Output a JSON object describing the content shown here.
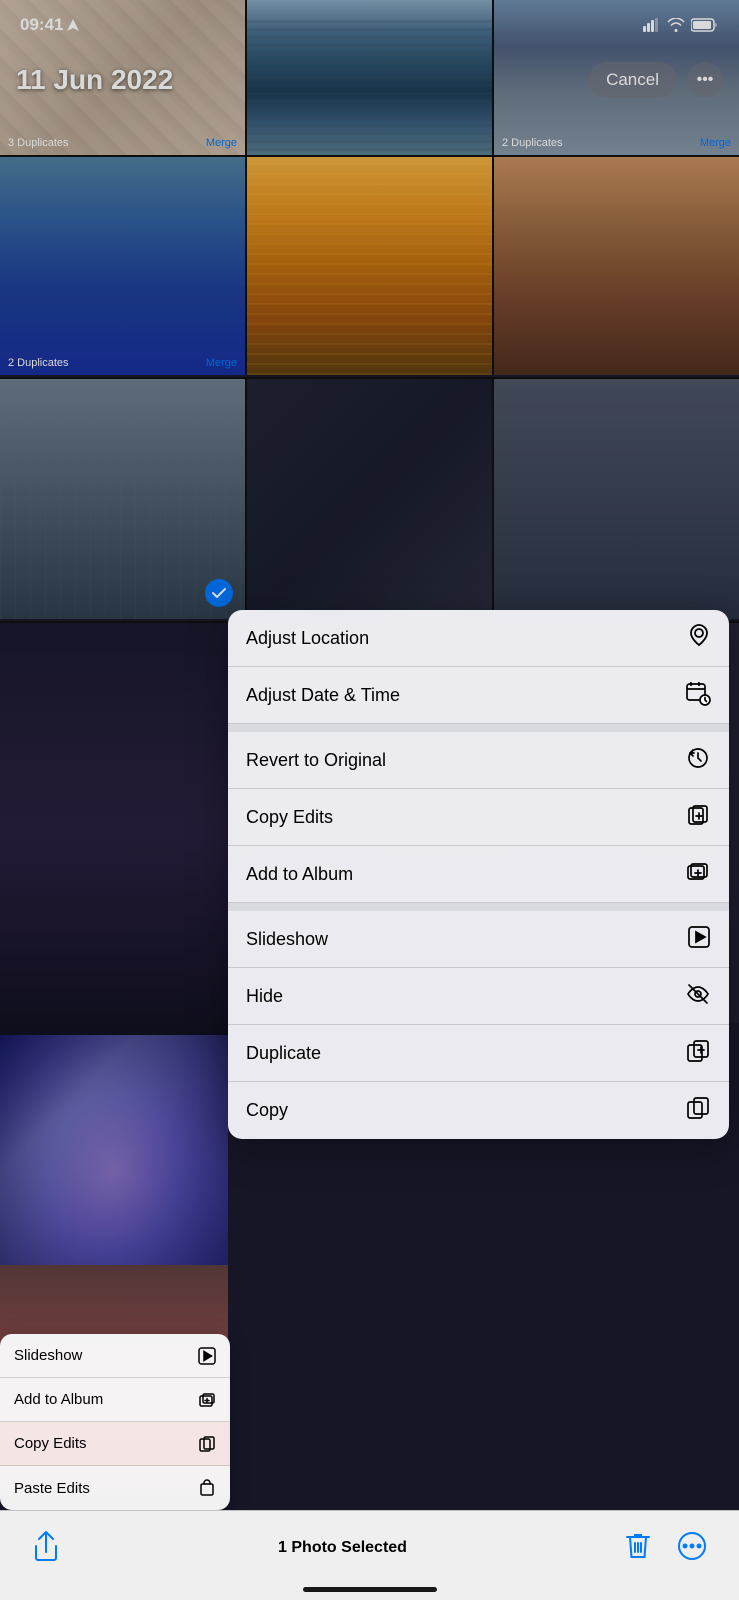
{
  "statusBar": {
    "time": "09:41",
    "locationArrow": "▶"
  },
  "header": {
    "date": "11 Jun 2022",
    "cancelLabel": "Cancel",
    "moreIcon": "•••"
  },
  "photoGrid": {
    "rows": [
      {
        "cells": [
          {
            "id": "p1",
            "dupLabel": "3 Duplicates",
            "mergeLabel": "Merge",
            "colorClass": "photo-1"
          },
          {
            "id": "p2",
            "dupLabel": "",
            "mergeLabel": "",
            "colorClass": "photo-2"
          },
          {
            "id": "p3",
            "dupLabel": "2 Duplicates",
            "mergeLabel": "Merge",
            "colorClass": "photo-3"
          }
        ]
      },
      {
        "cells": [
          {
            "id": "p4",
            "dupLabel": "2 Duplicates",
            "mergeLabel": "Merge",
            "colorClass": "photo-1-b"
          },
          {
            "id": "p5",
            "dupLabel": "",
            "mergeLabel": "",
            "colorClass": "photo-2-b"
          },
          {
            "id": "p6",
            "dupLabel": "",
            "mergeLabel": "",
            "colorClass": "photo-3-b"
          }
        ]
      }
    ]
  },
  "contextMenu": {
    "items": [
      {
        "id": "adjust-location",
        "label": "Adjust Location",
        "iconType": "location"
      },
      {
        "id": "adjust-date-time",
        "label": "Adjust Date & Time",
        "iconType": "calendar-clock"
      },
      {
        "id": "revert-original",
        "label": "Revert to Original",
        "iconType": "revert"
      },
      {
        "id": "copy-edits",
        "label": "Copy Edits",
        "iconType": "copy-edits"
      },
      {
        "id": "add-to-album",
        "label": "Add to Album",
        "iconType": "add-album"
      },
      {
        "id": "slideshow",
        "label": "Slideshow",
        "iconType": "play"
      },
      {
        "id": "hide",
        "label": "Hide",
        "iconType": "eye-slash"
      },
      {
        "id": "duplicate",
        "label": "Duplicate",
        "iconType": "duplicate"
      },
      {
        "id": "copy",
        "label": "Copy",
        "iconType": "copy"
      }
    ]
  },
  "miniMenu": {
    "items": [
      {
        "label": "Slideshow",
        "iconType": "play",
        "highlighted": false
      },
      {
        "label": "Add to Album",
        "iconType": "add-album",
        "highlighted": false
      },
      {
        "label": "Copy Edits",
        "iconType": "copy-edits",
        "highlighted": true
      },
      {
        "label": "Paste Edits",
        "iconType": "paste-edits",
        "highlighted": false
      }
    ]
  },
  "bottomToolbar": {
    "photoSelectedText": "1 Photo Selected"
  }
}
